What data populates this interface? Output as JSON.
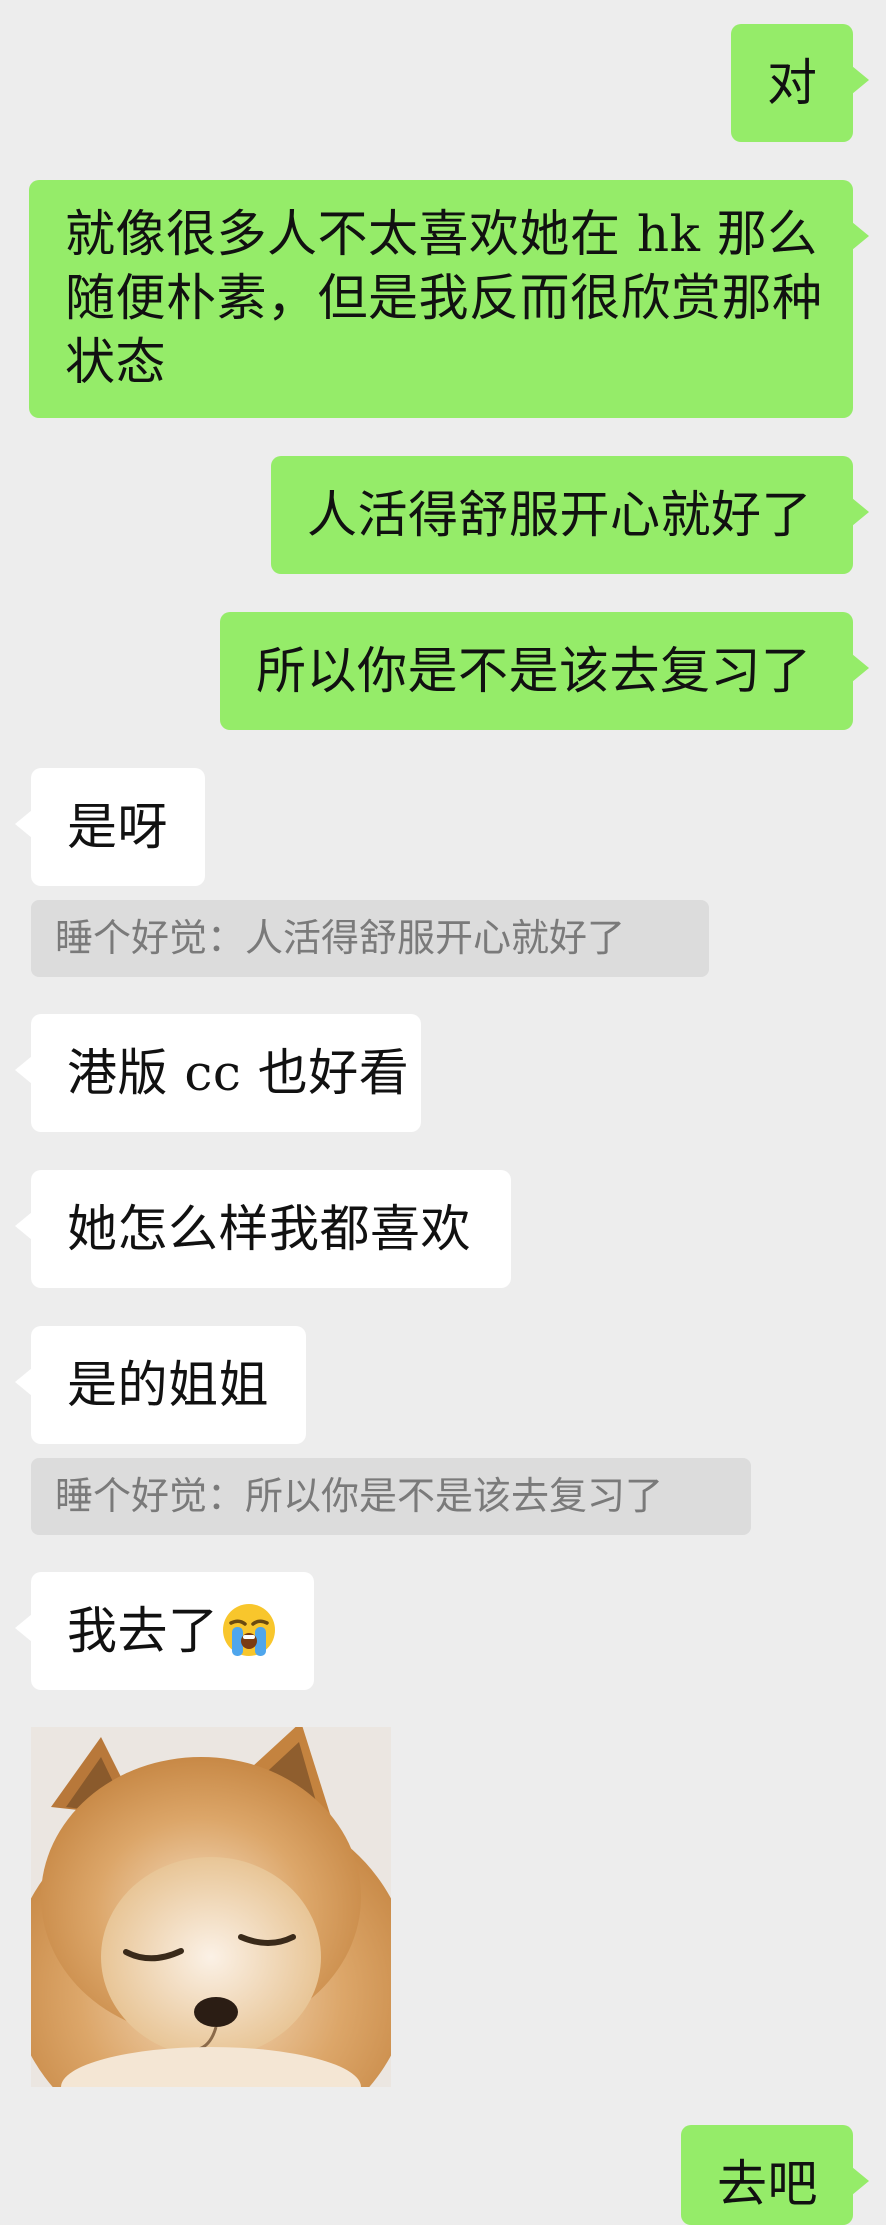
{
  "messages": [
    {
      "side": "me",
      "text": "对"
    },
    {
      "side": "me",
      "lines": [
        "就像很多人不太喜欢她在 hk 那么",
        "随便朴素，但是我反而很欣赏那种",
        "状态"
      ]
    },
    {
      "side": "me",
      "text": "人活得舒服开心就好了"
    },
    {
      "side": "me",
      "text": "所以你是不是该去复习了"
    },
    {
      "side": "them",
      "text": "是呀"
    },
    {
      "type": "quote",
      "text": "睡个好觉：人活得舒服开心就好了"
    },
    {
      "side": "them",
      "text": "港版 cc 也好看"
    },
    {
      "side": "them",
      "text": "她怎么样我都喜欢"
    },
    {
      "side": "them",
      "text": "是的姐姐"
    },
    {
      "type": "quote",
      "text": "睡个好觉：所以你是不是该去复习了"
    },
    {
      "side": "them",
      "text": "我去了",
      "emoji": "loudly-crying-face"
    },
    {
      "side": "them",
      "type": "sticker",
      "description": "pomeranian-dog-sticker"
    },
    {
      "side": "me",
      "text": "去吧",
      "partial": true
    }
  ],
  "colors": {
    "background": "#ededed",
    "my_bubble": "#95ec69",
    "their_bubble": "#ffffff",
    "quote_bg": "#dcdcdc",
    "quote_text": "#7a7a7a"
  }
}
